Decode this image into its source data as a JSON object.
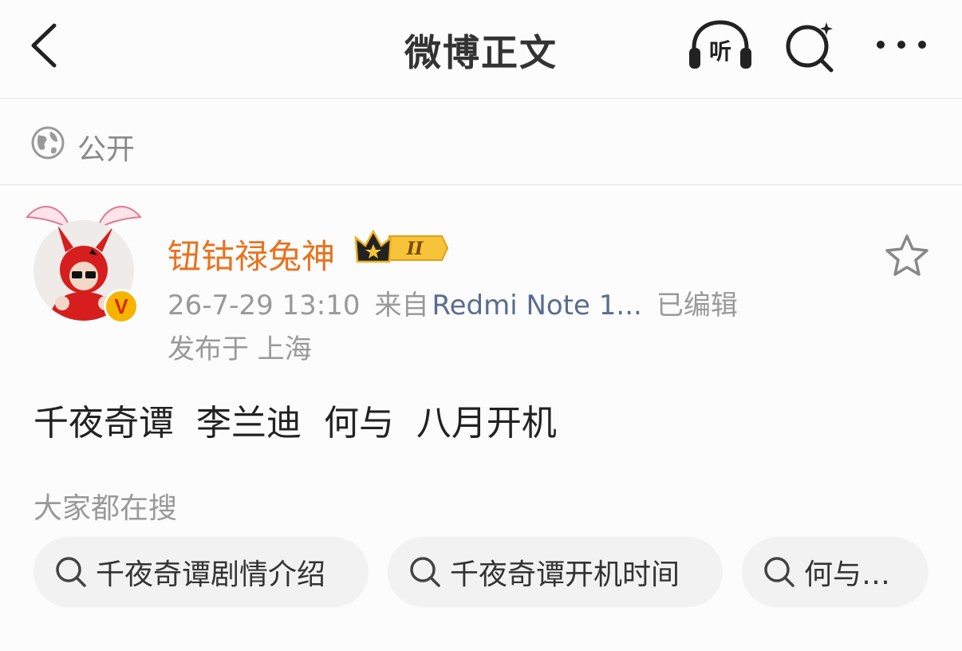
{
  "header": {
    "title": "微博正文",
    "listen_label": "听",
    "back_icon": "chevron-left-icon",
    "search_icon": "magnifier-sparkle-icon",
    "more_icon": "ellipsis-icon"
  },
  "visibility": {
    "label": "公开",
    "icon": "globe-icon"
  },
  "post": {
    "author": "钮钴禄兔神",
    "badge_level": "II",
    "verified_mark": "V",
    "date": "26-7-29 13:10",
    "source_prefix": "来自",
    "source_device": "Redmi Note 1...",
    "edited": "已编辑",
    "location": "发布于 上海",
    "text": "千夜奇谭  李兰迪  何与  八月开机"
  },
  "related": {
    "label": "大家都在搜",
    "items": [
      {
        "label": "千夜奇谭剧情介绍"
      },
      {
        "label": "千夜奇谭开机时间"
      },
      {
        "label": "何与…"
      }
    ]
  },
  "colors": {
    "username": "#e8731e",
    "device_link": "#5a6d8f",
    "secondary_text": "#999999",
    "chip_bg": "#f2f2f3"
  }
}
